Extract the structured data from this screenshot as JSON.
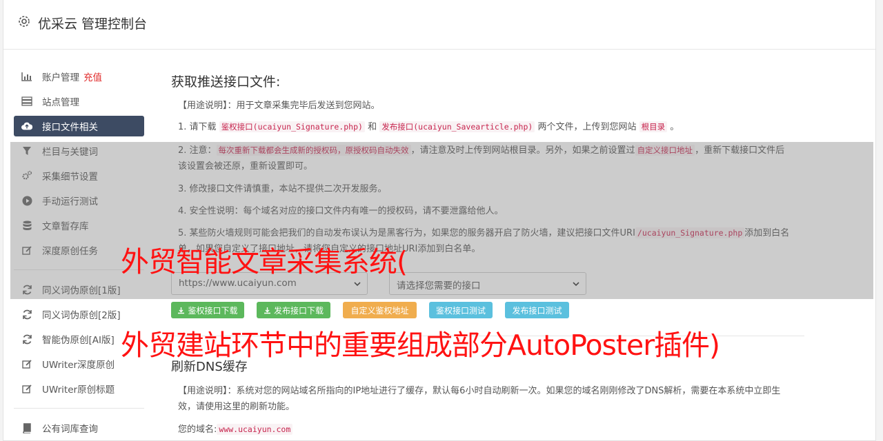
{
  "header": {
    "title": "优采云 管理控制台"
  },
  "sidebar": {
    "items": [
      {
        "label": "账户管理",
        "extra": "充值",
        "icon": "bar-chart-icon"
      },
      {
        "label": "站点管理",
        "icon": "server-icon"
      },
      {
        "label": "接口文件相关",
        "icon": "cloud-upload-icon",
        "active": true
      },
      {
        "label": "栏目与关键词",
        "icon": "filter-icon"
      },
      {
        "label": "采集细节设置",
        "icon": "gears-icon"
      },
      {
        "label": "手动运行测试",
        "icon": "play-circle-icon"
      },
      {
        "label": "文章暂存库",
        "icon": "database-icon"
      },
      {
        "label": "深度原创任务",
        "icon": "edit-icon"
      },
      {
        "label": "同义词伪原创[1版]",
        "icon": "refresh-icon"
      },
      {
        "label": "同义词伪原创[2版]",
        "icon": "refresh-icon"
      },
      {
        "label": "智能伪原创[AI版]",
        "icon": "refresh-icon"
      },
      {
        "label": "UWriter深度原创",
        "icon": "edit-icon"
      },
      {
        "label": "UWriter原创标题",
        "icon": "edit-icon"
      },
      {
        "label": "公有词库查询",
        "icon": "book-icon"
      }
    ]
  },
  "section1": {
    "title": "获取推送接口文件:",
    "usage": "【用途说明】：用于文章采集完毕后发送到您网站。",
    "step1": {
      "prefix": "1. 请下载",
      "code1": "鉴权接口(ucaiyun_Signature.php)",
      "and": "和",
      "code2": "发布接口(ucaiyun_Savearticle.php)",
      "mid": "两个文件，上传到您网站",
      "code3": "根目录",
      "end": "。"
    },
    "step2": {
      "prefix": "2. 注意：",
      "code1": "每次重新下载都会生成新的授权码，原授权码自动失效",
      "mid": "，请注意及时上传到网站根目录。另外，如果之前设置过",
      "code2": "自定义接口地址",
      "end": "，重新下载接口文件后该设置会被还原，重新设置即可。"
    },
    "step3": "3. 修改接口文件请慎重，本站不提供二次开发服务。",
    "step4": "4. 安全性说明：每个域名对应的接口文件内有唯一的授权码，请不要泄露给他人。",
    "step5": {
      "prefix": "5. 某些防火墙规则可能会把我们的自动发布误认为是黑客行为，如果您的服务器开启了防火墙，建议把接口文件URI",
      "code1": "/ucaiyun_Signature.php",
      "end": "添加到白名单，如果您自定义了接口地址，请将您自定义的接口地址URI添加到白名单。"
    },
    "domain_select": "https://www.ucaiyun.com",
    "interface_select": "请选择您需要的接口",
    "buttons": [
      "鉴权接口下载",
      "发布接口下载",
      "自定义鉴权地址",
      "鉴权接口测试",
      "发布接口测试"
    ]
  },
  "section2": {
    "title": "刷新DNS缓存",
    "usage": "【用途说明】：系统对您的网站域名所指向的IP地址进行了缓存，默认每6小时自动刷新一次。如果您的域名刚刚修改了DNS解析，需要在本系统中立即生效，请使用这里的刷新功能。",
    "domain_label": "您的域名:",
    "domain": "www.ucaiyun.com"
  },
  "overlay_text": {
    "line1": "外贸智能文章采集系统(",
    "line2": "外贸建站环节中的重要组成部分AutoPoster插件)"
  },
  "colors": {
    "active_bg": "#3d4b63",
    "green": "#5cb85c",
    "orange": "#f0ad4e",
    "blue": "#5bc0de",
    "red_text": "#ff1212"
  }
}
